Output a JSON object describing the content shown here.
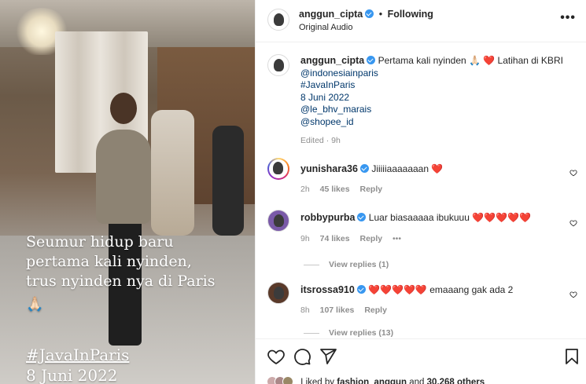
{
  "media": {
    "caption_lines": [
      "Seumur hidup baru",
      "pertama kali nyinden,",
      "trus nyinden nya di Paris"
    ],
    "caption_emoji": "🙏🏻",
    "hashtag": "#JavaInParis",
    "date": "8 Juni 2022"
  },
  "header": {
    "username": "anggun_cipta",
    "separator": "•",
    "follow_label": "Following",
    "audio": "Original Audio",
    "more": "•••"
  },
  "caption": {
    "username": "anggun_cipta",
    "text": "Pertama kali nyinden 🙏🏻 ❤️ Latihan di KBRI",
    "links": [
      "@indonesiainparis",
      "#JavaInParis"
    ],
    "date_line": "8 Juni 2022",
    "mentions": [
      "@le_bhv_marais",
      "@shopee_id"
    ],
    "meta": "Edited · 9h"
  },
  "comments": [
    {
      "username": "yunishara36",
      "text": "Jiiiiiaaaaaaan",
      "hearts": "❤️",
      "time": "2h",
      "likes": "45 likes",
      "reply": "Reply"
    },
    {
      "username": "robbypurba",
      "text": "Luar biasaaaaa ibukuuu",
      "hearts": "❤️❤️❤️❤️❤️",
      "time": "9h",
      "likes": "74 likes",
      "reply": "Reply",
      "more": "•••",
      "view_replies": "View replies (1)"
    },
    {
      "username": "itsrossa910",
      "text": "emaaang gak ada 2",
      "hearts_before": "❤️❤️❤️❤️❤️",
      "time": "8h",
      "likes": "107 likes",
      "reply": "Reply",
      "view_replies": "View replies (13)"
    }
  ],
  "footer": {
    "liked_prefix": "Liked by",
    "liked_user": "fashion_anggun",
    "liked_mid": "and",
    "liked_count": "30,268 others"
  },
  "colors": {
    "link": "#00376b",
    "verified": "#3897f0",
    "heart": "#ed1c24",
    "meta": "#8e8e8e"
  }
}
